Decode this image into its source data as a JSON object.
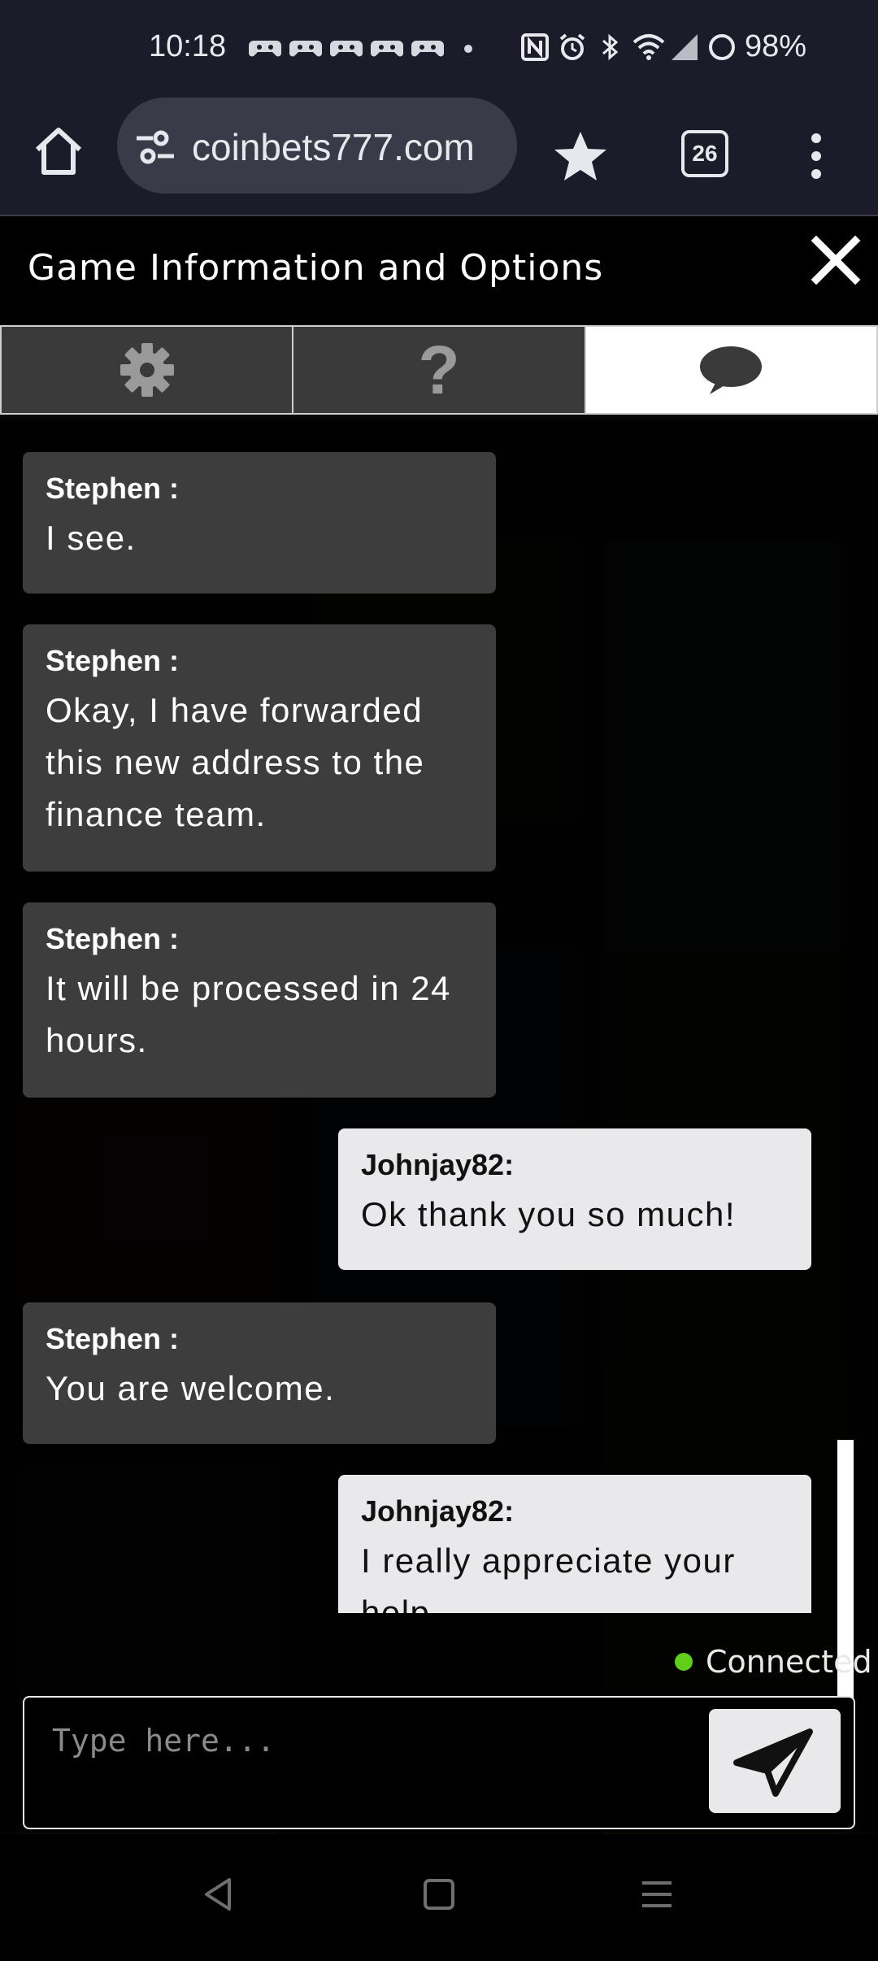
{
  "status_bar": {
    "time": "10:18",
    "battery": "98%",
    "notification_icons": [
      "game-controller-icon",
      "game-controller-icon",
      "game-controller-icon",
      "game-controller-icon",
      "game-controller-icon",
      "dot-icon"
    ],
    "system_icons": [
      "nfc-icon",
      "alarm-icon",
      "bluetooth-icon",
      "wifi-icon",
      "signal-icon",
      "battery-icon"
    ]
  },
  "browser": {
    "url": "coinbets777.com",
    "tab_count": "26"
  },
  "modal": {
    "title": "Game Information and Options",
    "tabs": [
      {
        "icon": "gear-icon",
        "active": false
      },
      {
        "label": "?",
        "icon": "question-icon",
        "active": false
      },
      {
        "icon": "chat-bubble-icon",
        "active": true
      }
    ]
  },
  "chat": {
    "messages": [
      {
        "sender": "Stephen :",
        "text": "I see.",
        "from": "agent"
      },
      {
        "sender": "Stephen :",
        "text": "Okay, I have forwarded this new address to the finance team.",
        "from": "agent"
      },
      {
        "sender": "Stephen :",
        "text": "It will be processed in 24 hours.",
        "from": "agent"
      },
      {
        "sender": "Johnjay82:",
        "text": "Ok thank you so much!",
        "from": "user"
      },
      {
        "sender": "Stephen :",
        "text": "You are welcome.",
        "from": "agent"
      },
      {
        "sender": "Johnjay82:",
        "text": "I really appreciate your help",
        "from": "user"
      }
    ],
    "connection_status": "Connected",
    "status_color": "#5fcf1a",
    "input_placeholder": "Type here..."
  },
  "colors": {
    "agent_bubble": "#3d3d3d",
    "user_bubble": "#e9e9eb",
    "header_bg": "#1b1b29"
  }
}
